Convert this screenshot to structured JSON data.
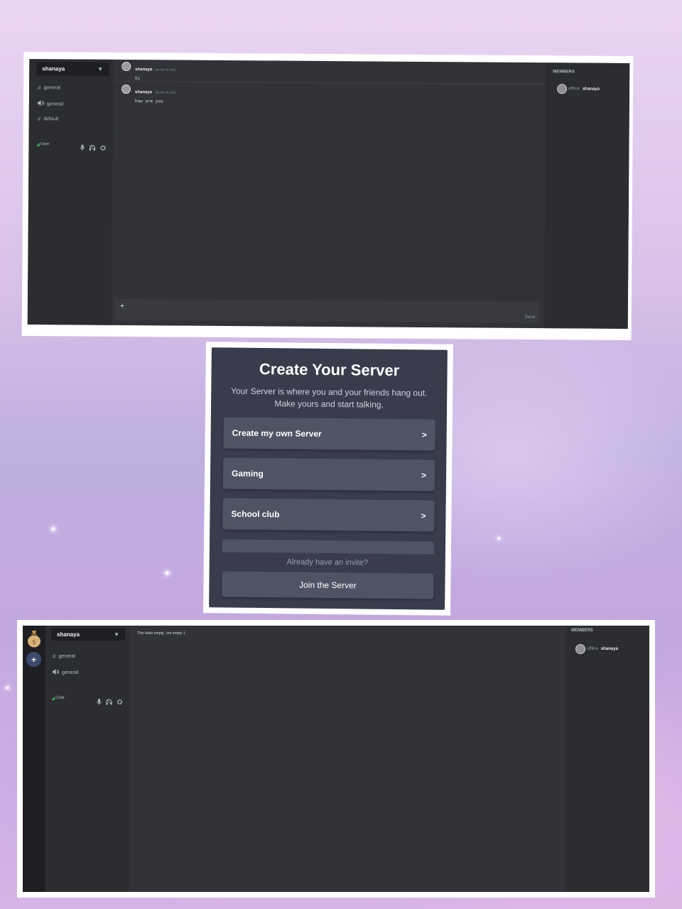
{
  "panel1": {
    "server_name": "shanaya",
    "channels": [
      {
        "icon": "hash-icon",
        "glyph": "#",
        "name": "general"
      },
      {
        "icon": "speaker-icon",
        "glyph": "🔊",
        "name": "general"
      },
      {
        "icon": "hash-icon",
        "glyph": "#",
        "name": "default"
      }
    ],
    "user_label": "User",
    "messages": [
      {
        "author": "shanaya",
        "timestamp": "Sat Jan 25 2025",
        "text": "hi"
      },
      {
        "author": "shanaya",
        "timestamp": "Sat Jan 25 2025",
        "text": "how are you"
      }
    ],
    "composer": {
      "plus": "+",
      "send_label": "Send"
    },
    "members_title": "MEMBERS",
    "member": {
      "status": "offline",
      "name": "shanaya"
    }
  },
  "modal": {
    "title": "Create Your Server",
    "subtitle_line1": "Your Server is where you and your friends hang out.",
    "subtitle_line2": "Make yours and start talking.",
    "options": [
      {
        "label": "Create my own Server",
        "chevron": ">"
      },
      {
        "label": "Gaming",
        "chevron": ">"
      },
      {
        "label": "School club",
        "chevron": ">"
      }
    ],
    "invite_text": "Already have an invite?",
    "join_label": "Join the Server"
  },
  "panel3": {
    "server_name": "shanaya",
    "add_server": "+",
    "channels": [
      {
        "icon": "hash-icon",
        "glyph": "#",
        "name": "general"
      },
      {
        "icon": "speaker-icon",
        "glyph": "🔊",
        "name": "general"
      }
    ],
    "user_label": "User",
    "empty_text": "This looks empty.. too empty :(",
    "members_title": "MEMBERS",
    "member": {
      "status": "offline",
      "name": "shanaya"
    }
  },
  "colors": {
    "app_bg": "#313338",
    "sidebar_bg": "#2b2d31",
    "rail_bg": "#1e1f22",
    "modal_bg": "#383c4b",
    "option_bg": "#4f5465",
    "add_server_bg": "#3c4a6e"
  }
}
